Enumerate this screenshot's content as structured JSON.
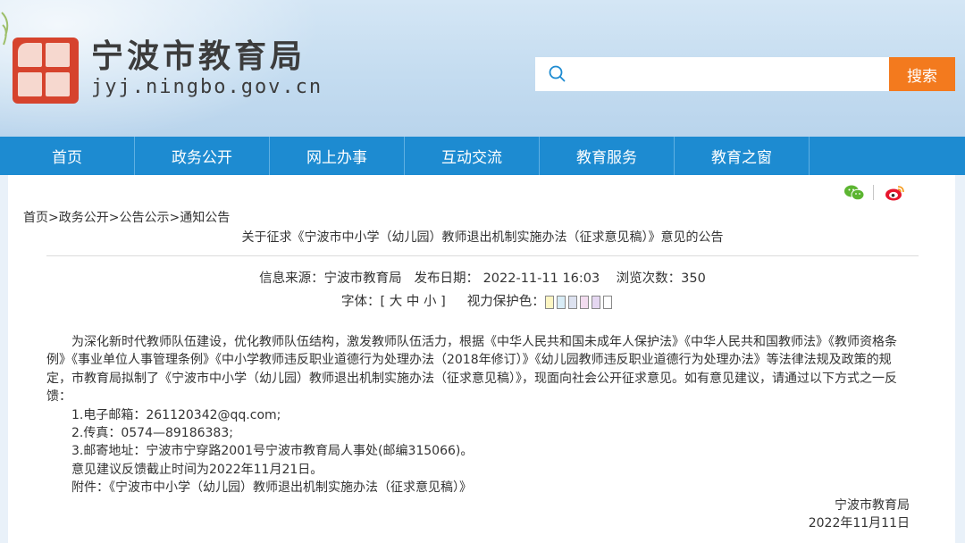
{
  "header": {
    "site_name": "宁波市教育局",
    "domain": "jyj.ningbo.gov.cn",
    "search_placeholder": "",
    "search_button": "搜索"
  },
  "nav": {
    "items": [
      {
        "label": "首页"
      },
      {
        "label": "政务公开"
      },
      {
        "label": "网上办事"
      },
      {
        "label": "互动交流"
      },
      {
        "label": "教育服务"
      },
      {
        "label": "教育之窗"
      }
    ]
  },
  "breadcrumb": "首页>政务公开>公告公示>通知公告",
  "article": {
    "title": "关于征求《宁波市中小学（幼儿园）教师退出机制实施办法（征求意见稿）》意见的公告",
    "meta_line": "信息来源：宁波市教育局   发布日期： 2022-11-11 16:03    浏览次数：350",
    "font_label": "字体：[ 大 中 小 ]",
    "eye_care_label": "视力保护色：",
    "eye_care_colors": [
      "#fdf6c3",
      "#d8ecf6",
      "#dde2f0",
      "#f2dcef",
      "#e5d7f1",
      "#ffffff"
    ],
    "paragraph": "为深化新时代教师队伍建设，优化教师队伍结构，激发教师队伍活力，根据《中华人民共和国未成年人保护法》《中华人民共和国教师法》《教师资格条例》《事业单位人事管理条例》《中小学教师违反职业道德行为处理办法（2018年修订）》《幼儿园教师违反职业道德行为处理办法》等法律法规及政策的规定，市教育局拟制了《宁波市中小学（幼儿园）教师退出机制实施办法（征求意见稿）》，现面向社会公开征求意见。如有意见建议，请通过以下方式之一反馈：",
    "lines": [
      "1.电子邮箱：261120342@qq.com;",
      "2.传真：0574—89186383;",
      "3.邮寄地址：宁波市宁穿路2001号宁波市教育局人事处(邮编315066)。",
      "意见建议反馈截止时间为2022年11月21日。",
      "附件：《宁波市中小学（幼儿园）教师退出机制实施办法（征求意见稿）》"
    ],
    "signature_org": "宁波市教育局",
    "signature_date": "2022年11月11日"
  },
  "colors": {
    "nav": "#1d8bd1",
    "search_button": "#f37a1e",
    "seal": "#d6432d"
  }
}
